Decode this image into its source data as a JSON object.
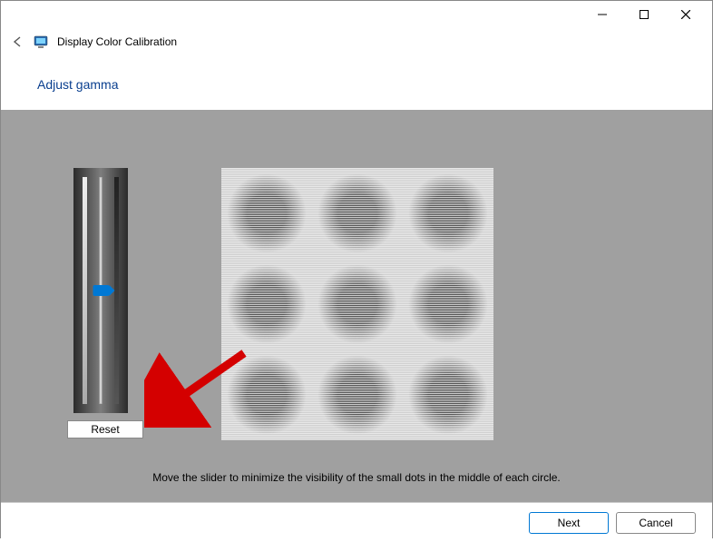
{
  "window": {
    "title": "Display Color Calibration"
  },
  "header": {
    "heading": "Adjust gamma"
  },
  "controls": {
    "reset_label": "Reset"
  },
  "instruction": "Move the slider to minimize the visibility of the small dots in the middle of each circle.",
  "footer": {
    "next_label": "Next",
    "cancel_label": "Cancel"
  }
}
